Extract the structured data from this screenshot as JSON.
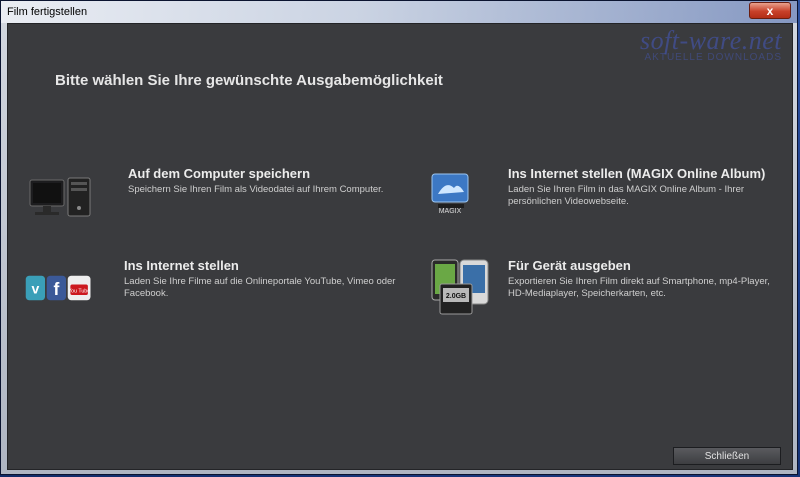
{
  "window": {
    "title": "Film fertigstellen",
    "close_symbol": "x"
  },
  "watermark": {
    "main": "soft-ware.net",
    "sub": "AKTUELLE DOWNLOADS"
  },
  "heading": "Bitte wählen Sie Ihre gewünschte Ausgabemöglichkeit",
  "options": [
    {
      "title": "Auf dem Computer speichern",
      "description": "Speichern Sie Ihren Film als Videodatei auf Ihrem Computer.",
      "icon": "computer-icon"
    },
    {
      "title": "Ins Internet stellen (MAGIX Online Album)",
      "description": "Laden Sie Ihren Film in das MAGIX Online Album - Ihrer persönlichen Videowebseite.",
      "icon": "magix-online-album-icon"
    },
    {
      "title": "Ins Internet stellen",
      "description": "Laden Sie Ihre Filme auf die Onlineportale YouTube, Vimeo oder Facebook.",
      "icon": "social-portals-icon"
    },
    {
      "title": "Für Gerät ausgeben",
      "description": "Exportieren Sie Ihren Film direkt auf Smartphone, mp4-Player, HD-Mediaplayer, Speicherkarten, etc.",
      "icon": "device-icon"
    }
  ],
  "icons": {
    "magix_label": "MAGIX",
    "vimeo_letter": "v",
    "facebook_letter": "f",
    "youtube_label": "You Tube",
    "sd_card_label": "2.0GB"
  },
  "buttons": {
    "close": "Schließen"
  },
  "colors": {
    "client_bg": "#3a3b3e",
    "title_close": "#c8412a"
  }
}
